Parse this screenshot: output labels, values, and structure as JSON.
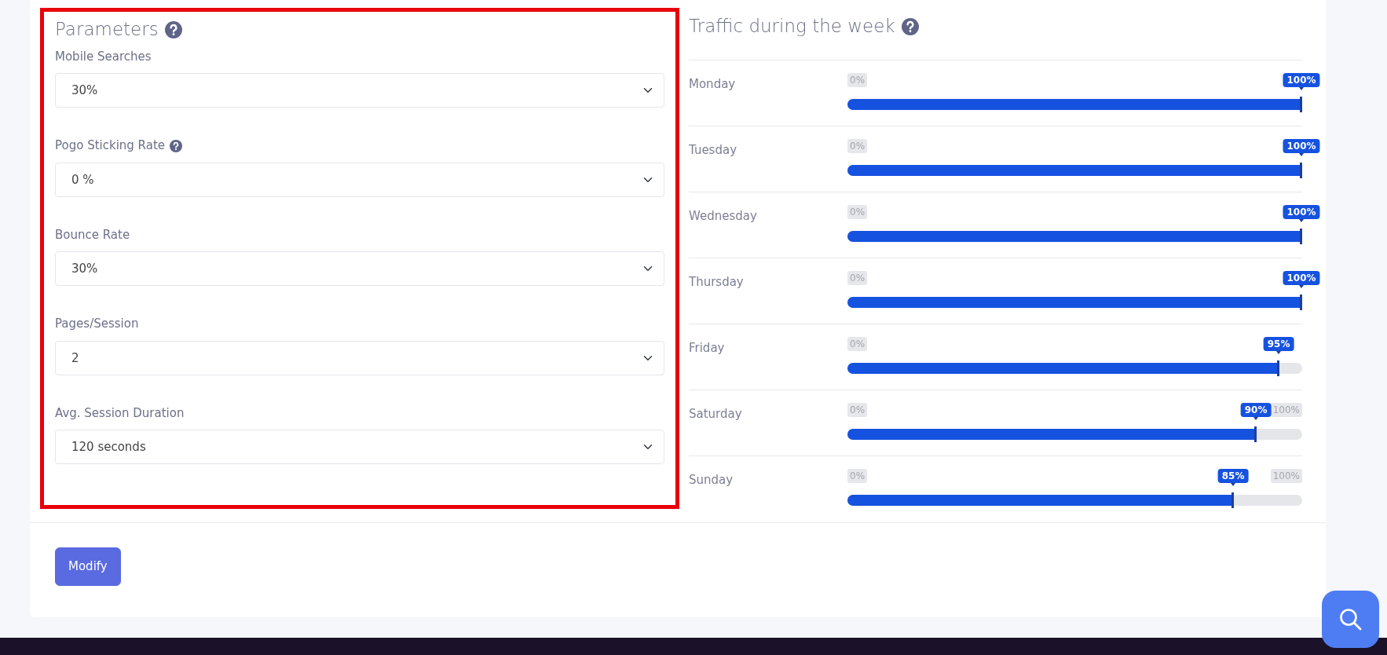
{
  "parameters": {
    "title": "Parameters",
    "highlighted": true,
    "fields": [
      {
        "label": "Mobile Searches",
        "help": false,
        "value": "30%"
      },
      {
        "label": "Pogo Sticking Rate",
        "help": true,
        "value": "0 %"
      },
      {
        "label": "Bounce Rate",
        "help": false,
        "value": "30%"
      },
      {
        "label": "Pages/Session",
        "help": false,
        "value": "2"
      },
      {
        "label": "Avg. Session Duration",
        "help": false,
        "value": "120 seconds"
      }
    ]
  },
  "traffic": {
    "title": "Traffic during the week",
    "days": [
      {
        "day": "Monday",
        "min_label": "0%",
        "value_label": "100%",
        "level": 1.0
      },
      {
        "day": "Tuesday",
        "min_label": "0%",
        "value_label": "100%",
        "level": 1.0
      },
      {
        "day": "Wednesday",
        "min_label": "0%",
        "value_label": "100%",
        "level": 1.0
      },
      {
        "day": "Thursday",
        "min_label": "0%",
        "value_label": "100%",
        "level": 1.0
      },
      {
        "day": "Friday",
        "min_label": "0%",
        "value_label": "95%",
        "level": 0.95
      },
      {
        "day": "Saturday",
        "min_label": "0%",
        "value_label": "90%",
        "max_label": "100%",
        "level": 0.9
      },
      {
        "day": "Sunday",
        "min_label": "0%",
        "value_label": "85%",
        "max_label": "100%",
        "level": 0.85
      }
    ]
  },
  "modify_button": "Modify"
}
